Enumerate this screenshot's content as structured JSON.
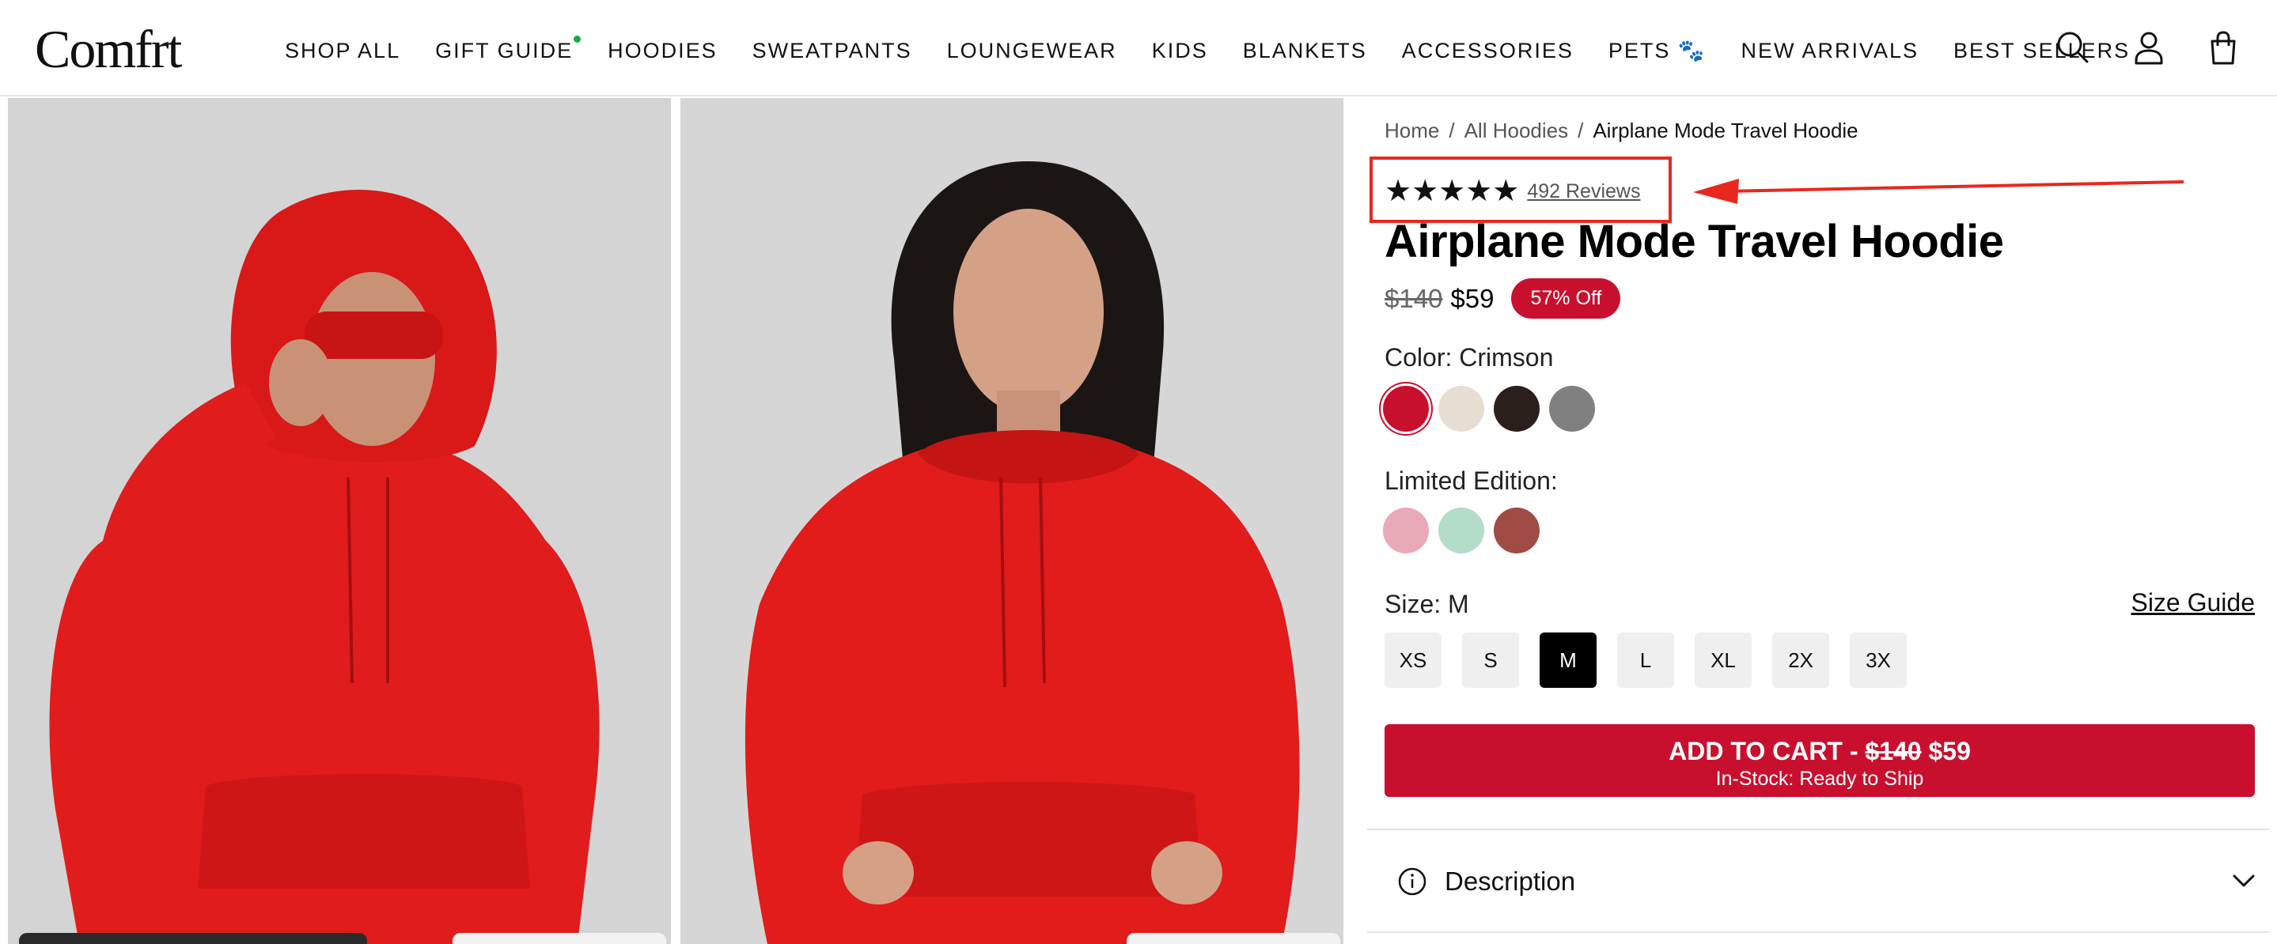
{
  "header": {
    "logo": "Comfrt",
    "nav": [
      {
        "label": "SHOP ALL"
      },
      {
        "label": "GIFT GUIDE",
        "dot": true
      },
      {
        "label": "HOODIES"
      },
      {
        "label": "SWEATPANTS"
      },
      {
        "label": "LOUNGEWEAR"
      },
      {
        "label": "KIDS"
      },
      {
        "label": "BLANKETS"
      },
      {
        "label": "ACCESSORIES"
      },
      {
        "label": "PETS 🐾"
      },
      {
        "label": "NEW ARRIVALS"
      },
      {
        "label": "BEST SELLERS"
      }
    ],
    "icons": [
      "search-icon",
      "account-icon",
      "cart-icon"
    ]
  },
  "breadcrumb": {
    "home": "Home",
    "sep1": "/",
    "category": "All Hoodies",
    "sep2": "/",
    "current": "Airplane Mode Travel Hoodie"
  },
  "rating": {
    "stars": "★★★★★",
    "value": 5,
    "reviews_label": "492 Reviews"
  },
  "product": {
    "title": "Airplane Mode Travel Hoodie",
    "price_old": "$140",
    "price_new": "$59",
    "discount_badge": "57% Off"
  },
  "color": {
    "label": "Color: Crimson",
    "swatches": [
      {
        "name": "Crimson",
        "hex": "#c8102e",
        "selected": true
      },
      {
        "name": "Cream",
        "hex": "#e6ded3"
      },
      {
        "name": "Dark Brown",
        "hex": "#2b1f1c"
      },
      {
        "name": "Grey",
        "hex": "#808080"
      }
    ]
  },
  "limited": {
    "label": "Limited Edition:",
    "swatches": [
      {
        "name": "Pink",
        "hex": "#e8aab7"
      },
      {
        "name": "Mint",
        "hex": "#b3dcc9"
      },
      {
        "name": "Rust",
        "hex": "#a04b43"
      }
    ]
  },
  "size": {
    "label": "Size: M",
    "guide_label": "Size Guide",
    "options": [
      "XS",
      "S",
      "M",
      "L",
      "XL",
      "2X",
      "3X"
    ],
    "selected": "M"
  },
  "cart": {
    "prefix": "ADD TO CART - ",
    "price_old": "$140",
    "price_new": "$59",
    "stock": "In-Stock: Ready to Ship"
  },
  "description": {
    "label": "Description"
  },
  "colors": {
    "accent": "#c8102e",
    "annotation": "#e8281e"
  }
}
